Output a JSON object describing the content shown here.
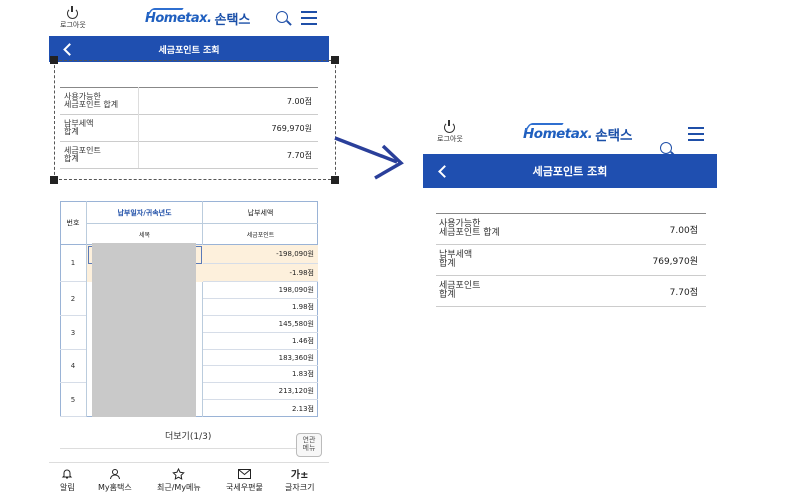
{
  "left_panel": {
    "logout_label": "로그아웃",
    "brand_home": "Hometax.",
    "brand_son": "손택스",
    "title": "세금포인트 조회",
    "summary": [
      {
        "label": "사용가능한\n세금포인트 합계",
        "value": "7.00점"
      },
      {
        "label": "납부세액\n합계",
        "value": "769,970원"
      },
      {
        "label": "세금포인트\n합계",
        "value": "7.70점"
      }
    ],
    "table": {
      "header_no": "번호",
      "header_date": "납부일자/귀속년도",
      "header_tax_item": "세목",
      "header_paid": "납부세액",
      "header_points": "세금포인트",
      "rows": [
        {
          "no": "1",
          "amount": "-198,090원",
          "points": "-1.98점"
        },
        {
          "no": "2",
          "amount": "198,090원",
          "points": "1.98점"
        },
        {
          "no": "3",
          "amount": "145,580원",
          "points": "1.46점"
        },
        {
          "no": "4",
          "amount": "183,360원",
          "points": "1.83점"
        },
        {
          "no": "5",
          "amount": "213,120원",
          "points": "2.13점"
        }
      ]
    },
    "more_label": "더보기(1/3)",
    "related_menu_label": "연관\n메뉴",
    "bottom_nav": [
      {
        "label": "알림",
        "icon": "bell-icon"
      },
      {
        "label": "My홈택스",
        "icon": "person-icon"
      },
      {
        "label": "최근/My메뉴",
        "icon": "star-icon"
      },
      {
        "label": "국세우편물",
        "icon": "mail-icon"
      },
      {
        "label": "글자크기",
        "icon": "font-size-icon",
        "glyph": "가±"
      }
    ]
  },
  "right_panel": {
    "logout_label": "로그아웃",
    "brand_home": "Hometax.",
    "brand_son": "손택스",
    "title": "세금포인트 조회",
    "summary": [
      {
        "label": "사용가능한\n세금포인트 합계",
        "value": "7.00점"
      },
      {
        "label": "납부세액\n합계",
        "value": "769,970원"
      },
      {
        "label": "세금포인트\n합계",
        "value": "7.70점"
      }
    ]
  },
  "colors": {
    "brand_blue": "#1f4fb0",
    "highlight_row": "#fdf0dc",
    "arrow": "#2a3f9a"
  }
}
